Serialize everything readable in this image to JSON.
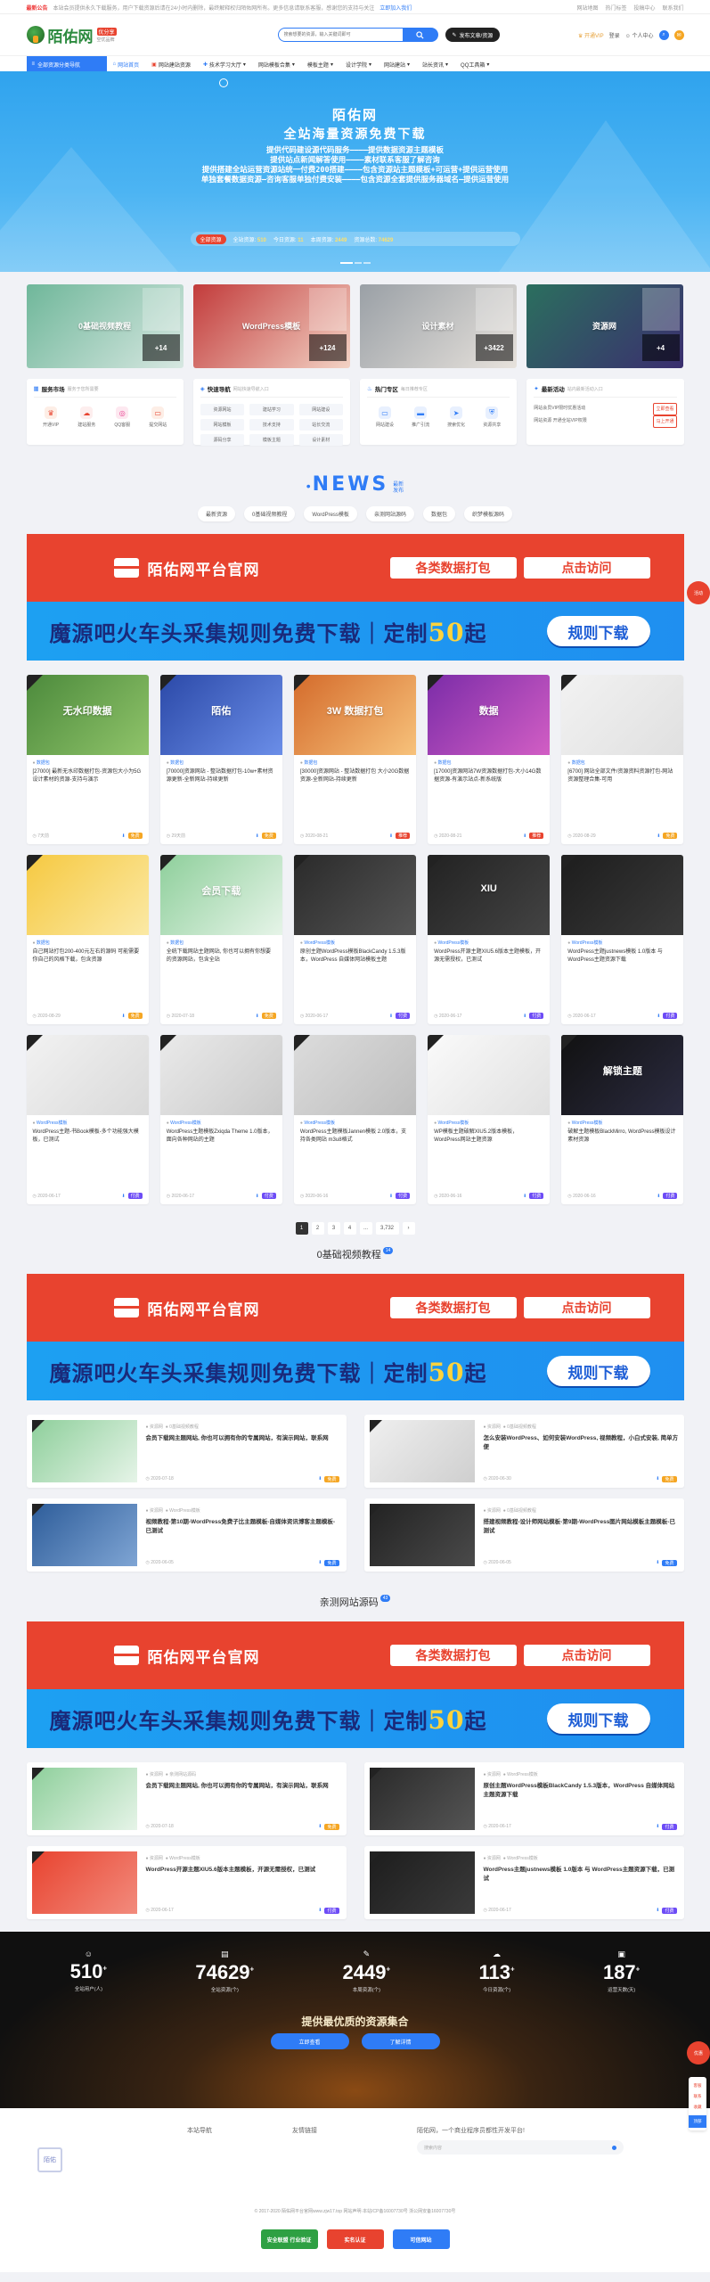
{
  "notice": {
    "tag": "最新公告",
    "text": "本站会员提供永久下载服务，用户下载资源后请在24小时内删除，最终解释权归陌佑网所有。更多信息请联系客服，感谢您的支持与关注",
    "join_link": "立即加入我们",
    "links": [
      "网站地图",
      "热门标签",
      "投稿中心",
      "联系我们"
    ]
  },
  "header": {
    "logo_text": "陌佑网",
    "badge1": "优分享",
    "badge2": "空优品牌",
    "search_placeholder": "搜索想要的资源，输入关键词即可",
    "publish_label": "发布文章/资源",
    "vip_label": "开通VIP",
    "login_label": "登录",
    "user_label": "个人中心"
  },
  "nav": {
    "category": "全部资源分类导航",
    "items": [
      "网站首页",
      "网站建站资源",
      "技术学习大厅",
      "网站模板合集",
      "模板主题",
      "设计学院",
      "网站建站",
      "站长资讯",
      "QQ工具箱"
    ]
  },
  "banner": {
    "title": "陌佑网",
    "subtitle": "全站海量资源免费下载",
    "lines": [
      "提供代码建设源代码服务————提供数据资源主题模板",
      "提供站点新闻解答使用————素材联系客服了解咨询",
      "提供搭建全站运营资源站统一付费200搭建————包含资源站主题模板+可运营+提供运营使用",
      "单独套餐数据资源—咨询客服单独付费安装————包含资源全套提供服务器域名—提供运营使用"
    ],
    "stats_pill": "全部资源",
    "stats": [
      {
        "label": "全站资源",
        "value": "510"
      },
      {
        "label": "今日资源",
        "value": "11"
      },
      {
        "label": "本周资源",
        "value": "2449"
      },
      {
        "label": "资源总数",
        "value": "74629"
      }
    ]
  },
  "tiles": [
    {
      "title": "0基础视频教程",
      "count": "+14",
      "colors": [
        "#6fb79a",
        "#d7e7e1"
      ]
    },
    {
      "title": "WordPress模板",
      "count": "+124",
      "colors": [
        "#c23b3b",
        "#f3d3c5"
      ]
    },
    {
      "title": "设计素材",
      "count": "+3422",
      "colors": [
        "#9aa0a6",
        "#e7e2dc"
      ]
    },
    {
      "title": "资源网",
      "count": "+4",
      "colors": [
        "#2b6f5e",
        "#3b2e6f"
      ]
    }
  ],
  "services": [
    {
      "title": "服务市场",
      "sub": "服务于您所需要",
      "items": [
        "开通VIP",
        "建站服务",
        "QQ客服",
        "提交网站"
      ]
    },
    {
      "title": "快速导航",
      "sub": "网站快速导航入口",
      "items": [
        "资源网站",
        "建站学习",
        "网站建设",
        "网站模板",
        "技术支持",
        "站长交流",
        "源码分享",
        "模板主题",
        "设计素材"
      ]
    },
    {
      "title": "热门专区",
      "sub": "每日推荐专区",
      "items": [
        "网站建设",
        "推广引流",
        "搜索优化",
        "资源共享"
      ]
    },
    {
      "title": "最新活动",
      "sub": "站内最新活动入口",
      "items": [
        {
          "text": "网站会员VIP限时优惠活动",
          "tag": "立即查看"
        },
        {
          "text": "网站资源 开通全站VIP权限",
          "tag": "马上开通"
        }
      ]
    }
  ],
  "news": {
    "title": "NEWS",
    "small1": "最新",
    "small2": "发布",
    "tabs": [
      "最新资源",
      "0基础视频教程",
      "WordPress模板",
      "亲测网站源码",
      "数据包",
      "织梦模板源码"
    ]
  },
  "ads": {
    "red_title": "陌佑网平台官网",
    "red_btn1": "各类数据打包",
    "red_btn2": "点击访问",
    "blue_text": "魔源吧火车头采集规则免费下载｜定制",
    "blue_num": "50",
    "blue_tail": "起",
    "blue_btn": "规则下载"
  },
  "cards": [
    {
      "title": "无水印数据",
      "cat": "数据包",
      "text": "[27000] 最新无水印数据打包-资源包大小为5G 设计素材的资源-支持与演示",
      "date": "7天前",
      "badge": "免费",
      "badgeColor": "#f5a623",
      "colors": [
        "#4c8a3c",
        "#90c46a"
      ]
    },
    {
      "title": "陌佑",
      "cat": "数据包",
      "text": "[70000]资源网站 - 整站数据打包-10w+素材资源更新-全新网站-持续更新",
      "date": "29天前",
      "badge": "免费",
      "badgeColor": "#f5a623",
      "colors": [
        "#2b49a8",
        "#6b8ee8"
      ]
    },
    {
      "title": "3W 数据打包",
      "cat": "数据包",
      "text": "[30000]资源网站 - 整站数据打包 大小20G数据资源-全新网站-持续更新",
      "date": "2020-08-21",
      "badge": "推荐",
      "badgeColor": "#e8432f",
      "colors": [
        "#d46b2b",
        "#f7c27b"
      ]
    },
    {
      "title": "数据",
      "cat": "数据包",
      "text": "[17000]资源网站7W资源数据打包-大小14G数据资源-有演示站点-新系统版",
      "date": "2020-08-21",
      "badge": "推荐",
      "badgeColor": "#e8432f",
      "colors": [
        "#7b2ca8",
        "#d25ec4"
      ]
    },
    {
      "title": "",
      "cat": "数据包",
      "text": "[6700] 网站全部文件/资源资料资源打包-网站资源整理合集-可用",
      "date": "2020-08-29",
      "badge": "免费",
      "badgeColor": "#f5a623",
      "colors": [
        "#f2f2f2",
        "#e0e0e0"
      ]
    },
    {
      "title": "",
      "cat": "数据包",
      "text": "自己网站打包200-400元左右的源码 可能需要你自己的风格下载，包含资源",
      "date": "2020-08-29",
      "badge": "免费",
      "badgeColor": "#f5a623",
      "colors": [
        "#f6c941",
        "#fbe9a5"
      ]
    },
    {
      "title": "会员下载",
      "cat": "数据包",
      "text": "全统下载网站主题网站, 你也可以拥有你想要的资源网站，包含全站",
      "date": "2020-07-18",
      "badge": "免费",
      "badgeColor": "#f5a623",
      "colors": [
        "#8ecf9b",
        "#e6f4e8"
      ]
    },
    {
      "title": "",
      "cat": "WordPress模板",
      "text": "原创主题WordPress模板BlackCandy 1.5.3版本，WordPress 自媒体网站模板主题",
      "date": "2020-06-17",
      "badge": "付费",
      "badgeColor": "#6d4cf6",
      "colors": [
        "#2a2a2a",
        "#555"
      ]
    },
    {
      "title": "XIU",
      "cat": "WordPress模板",
      "text": "WordPress开源主题XIU5.6版本主题模板，开源无需授权，已测试",
      "date": "2020-06-17",
      "badge": "付费",
      "badgeColor": "#6d4cf6",
      "colors": [
        "#222",
        "#444"
      ]
    },
    {
      "title": "",
      "cat": "WordPress模板",
      "text": "WordPress主题justnews模板 1.0版本 与 WordPress主题资源下载",
      "date": "2020-06-17",
      "badge": "付费",
      "badgeColor": "#6d4cf6",
      "colors": [
        "#1d1d1d",
        "#3a3a3a"
      ]
    },
    {
      "title": "",
      "cat": "WordPress模板",
      "text": "WordPress主题-书Book模板-多个功能强大模板，已测试",
      "date": "2020-06-17",
      "badge": "付费",
      "badgeColor": "#6d4cf6",
      "colors": [
        "#f2f2f2",
        "#d9d9d9"
      ]
    },
    {
      "title": "",
      "cat": "WordPress模板",
      "text": "WordPress主题模板Zxiqda Theme 1.0版本，面向各种网站的主题",
      "date": "2020-06-17",
      "badge": "付费",
      "badgeColor": "#6d4cf6",
      "colors": [
        "#eaeaea",
        "#c9c9c9"
      ]
    },
    {
      "title": "",
      "cat": "WordPress模板",
      "text": "WordPress主题模板Jannen模板 2.0版本，支持各类网站 m3u8格式",
      "date": "2020-06-16",
      "badge": "付费",
      "badgeColor": "#6d4cf6",
      "colors": [
        "#dcdcdc",
        "#bdbdbd"
      ]
    },
    {
      "title": "",
      "cat": "WordPress模板",
      "text": "WP模板主题破解XIU5.2版本模板，WordPress网站主题资源",
      "date": "2020-06-16",
      "badge": "付费",
      "badgeColor": "#6d4cf6",
      "colors": [
        "#fafafa",
        "#e0e0e0"
      ]
    },
    {
      "title": "解锁主题",
      "cat": "WordPress模板",
      "text": "破解主题模板BlackMirro, WordPress模板设计素材资源",
      "date": "2020-06-16",
      "badge": "付费",
      "badgeColor": "#6d4cf6",
      "colors": [
        "#111",
        "#2b2b40"
      ]
    }
  ],
  "pager": [
    "1",
    "2",
    "3",
    "4",
    "...",
    "3,732",
    "›"
  ],
  "video_section": {
    "title": "0基础视频教程",
    "count": "14",
    "items": [
      {
        "cat": "资源网",
        "cat2": "0基础视频教程",
        "title": "会员下载网主题网站, 你也可以拥有你的专属网站，有演示网站，联系网",
        "date": "2020-07-18",
        "badge": "免费",
        "badgeColor": "#f5a623",
        "colors": [
          "#8ecf9b",
          "#e6f4e8"
        ]
      },
      {
        "cat": "资源网",
        "cat2": "0基础视频教程",
        "title": "怎么安装WordPress、如何安装WordPress, 视频教程，小白式安装, 简单方便",
        "date": "2020-06-30",
        "badge": "免费",
        "badgeColor": "#f5a623",
        "colors": [
          "#efefef",
          "#cfcfcf"
        ]
      },
      {
        "cat": "资源网",
        "cat2": "WordPress模板",
        "title": "视频教程-第10期-WordPress免费子比主题模板-自媒体资讯博客主题模板-已测试",
        "date": "2020-06-05",
        "badge": "免费",
        "badgeColor": "#2f7cf6",
        "colors": [
          "#2e5d9a",
          "#7fa5d4"
        ]
      },
      {
        "cat": "资源网",
        "cat2": "0基础视频教程",
        "title": "搭建视频教程-设计师网站模板-第9期-WordPress图片网站模板主题模板-已测试",
        "date": "2020-06-05",
        "badge": "免费",
        "badgeColor": "#2f7cf6",
        "colors": [
          "#222",
          "#4a4a4a"
        ]
      }
    ]
  },
  "source_section": {
    "title": "亲测网站源码",
    "count": "43",
    "items": [
      {
        "cat": "资源网",
        "cat2": "亲测网站源码",
        "title": "会员下载网主题网站, 你也可以拥有你的专属网站，有演示网站，联系网",
        "date": "2020-07-18",
        "badge": "免费",
        "badgeColor": "#f5a623",
        "colors": [
          "#8ecf9b",
          "#e6f4e8"
        ]
      },
      {
        "cat": "资源网",
        "cat2": "WordPress模板",
        "title": "原创主题WordPress模板BlackCandy 1.5.3版本，WordPress 自媒体网站主题资源下载",
        "date": "2020-06-17",
        "badge": "付费",
        "badgeColor": "#6d4cf6",
        "colors": [
          "#2a2a2a",
          "#555"
        ]
      },
      {
        "cat": "资源网",
        "cat2": "WordPress模板",
        "title": "WordPress开源主题XIU5.6版本主题模板，开源无需授权，已测试",
        "date": "2020-06-17",
        "badge": "付费",
        "badgeColor": "#6d4cf6",
        "colors": [
          "#e8432f",
          "#f28b7d"
        ]
      },
      {
        "cat": "资源网",
        "cat2": "WordPress模板",
        "title": "WordPress主题justnews模板 1.0版本 与 WordPress主题资源下载，已测试",
        "date": "2020-06-17",
        "badge": "付费",
        "badgeColor": "#6d4cf6",
        "colors": [
          "#1d1d1d",
          "#3a3a3a"
        ]
      }
    ]
  },
  "footer_stats": [
    {
      "icon": "☺",
      "value": "510",
      "label": "全站用户(人)"
    },
    {
      "icon": "▤",
      "value": "74629",
      "label": "全站资源(个)"
    },
    {
      "icon": "✎",
      "value": "2449",
      "label": "本周资源(个)"
    },
    {
      "icon": "☁",
      "value": "113",
      "label": "今日资源(个)"
    },
    {
      "icon": "▣",
      "value": "187",
      "label": "运营天数(天)"
    }
  ],
  "footer": {
    "slogan": "提供最优质的资源集合",
    "btn1": "立即查看",
    "btn2": "了解详情",
    "col1": "本站导航",
    "col2": "友情链接",
    "about": "陌佑网，一个商业程序员都性开发平台!",
    "search_placeholder": "搜索内容",
    "logo": "陌佑",
    "copyright": "© 2017-2020 陌佑网平台官网www.zjw17.top  网站声明·本站ICP备16007730号  浙公网安备16007730号",
    "trust": [
      "安全联盟 行业验证",
      "实名认证",
      "可信网站"
    ]
  },
  "floats": [
    "活动",
    "优惠",
    "客服",
    "联系",
    "收藏",
    "顶部"
  ]
}
